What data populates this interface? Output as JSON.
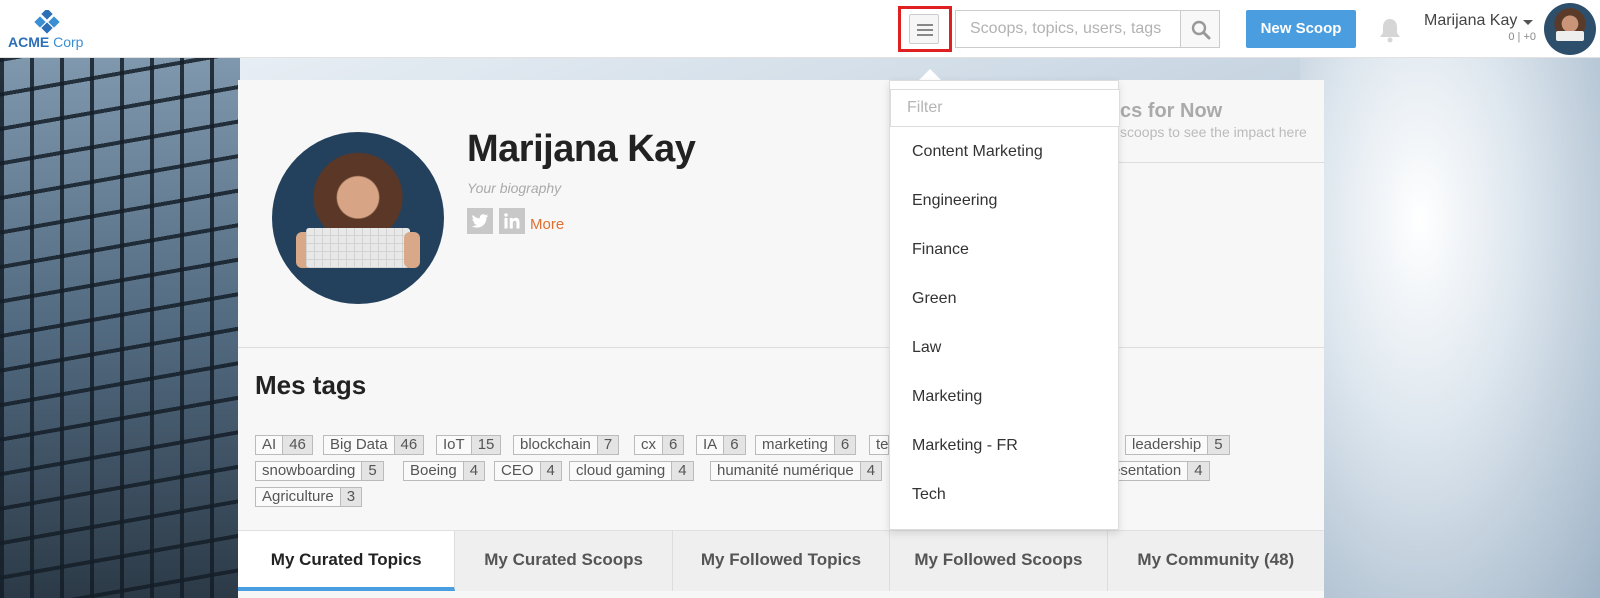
{
  "header": {
    "logo_text": "ACME",
    "logo_corp": "Corp",
    "search_placeholder": "Scoops, topics, users, tags",
    "new_scoop_label": "New Scoop",
    "user_name": "Marijana Kay",
    "user_stats": "0 | +0"
  },
  "profile": {
    "name": "Marijana Kay",
    "biography_placeholder": "Your biography",
    "more_label": "More",
    "stats_title": "cs for Now",
    "stats_sub": "scoops to see the impact here"
  },
  "tags": {
    "title": "Mes tags",
    "items": [
      {
        "label": "AI",
        "count": "46"
      },
      {
        "label": "Big Data",
        "count": "46"
      },
      {
        "label": "IoT",
        "count": "15"
      },
      {
        "label": "blockchain",
        "count": "7"
      },
      {
        "label": "cx",
        "count": "6"
      },
      {
        "label": "IA",
        "count": "6"
      },
      {
        "label": "marketing",
        "count": "6"
      },
      {
        "label": "te",
        "count": ""
      },
      {
        "label": "leadership",
        "count": "5"
      },
      {
        "label": "snowboarding",
        "count": "5"
      },
      {
        "label": "Boeing",
        "count": "4"
      },
      {
        "label": "CEO",
        "count": "4"
      },
      {
        "label": "cloud gaming",
        "count": "4"
      },
      {
        "label": "humanité numérique",
        "count": "4"
      },
      {
        "label": "esentation",
        "count": "4"
      },
      {
        "label": "Agriculture",
        "count": "3"
      }
    ]
  },
  "tabs": [
    {
      "label": "My Curated Topics"
    },
    {
      "label": "My Curated Scoops"
    },
    {
      "label": "My Followed Topics"
    },
    {
      "label": "My Followed Scoops"
    },
    {
      "label": "My Community (48)"
    }
  ],
  "dropdown": {
    "filter_placeholder": "Filter",
    "items": [
      {
        "label": "Content Marketing"
      },
      {
        "label": "Engineering"
      },
      {
        "label": "Finance"
      },
      {
        "label": "Green"
      },
      {
        "label": "Law"
      },
      {
        "label": "Marketing"
      },
      {
        "label": "Marketing - FR"
      },
      {
        "label": "Tech"
      }
    ]
  },
  "icons": {
    "menu": "hamburger-icon",
    "search": "search-icon",
    "notifications": "bell-icon",
    "twitter": "twitter-icon",
    "linkedin": "linkedin-icon"
  },
  "colors": {
    "accent": "#4a9ee0",
    "link": "#e0702e",
    "highlight": "#e02020"
  }
}
